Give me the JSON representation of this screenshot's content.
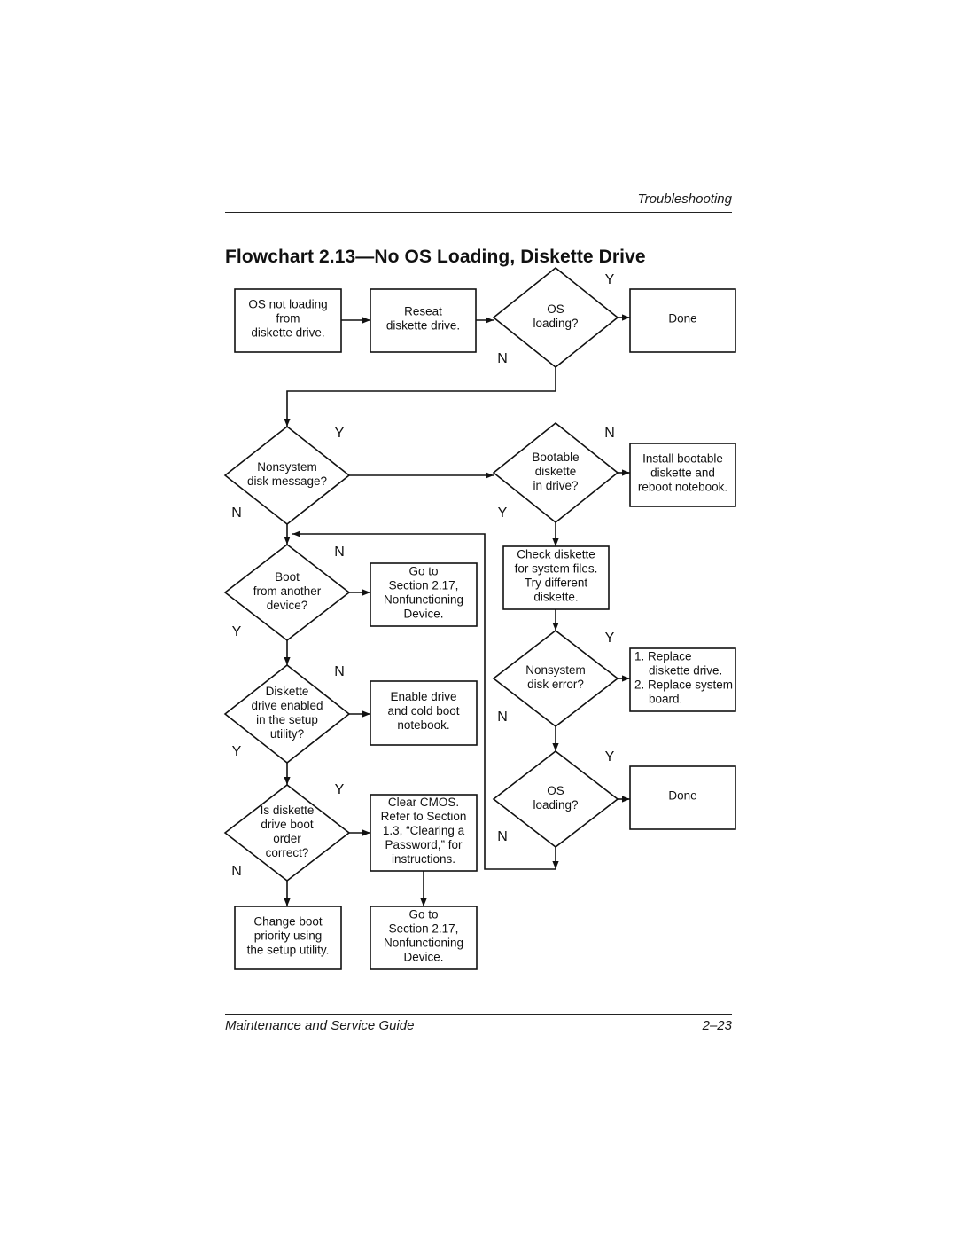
{
  "page": {
    "running_header": "Troubleshooting",
    "title": "Flowchart 2.13—No OS Loading, Diskette Drive",
    "footer_left": "Maintenance and Service Guide",
    "footer_right": "2–23"
  },
  "flowchart": {
    "nodes": {
      "start": {
        "type": "process",
        "lines": [
          "OS not loading",
          "from",
          "diskette drive."
        ]
      },
      "reseat": {
        "type": "process",
        "lines": [
          "Reseat",
          "diskette drive."
        ]
      },
      "os_loading_1": {
        "type": "decision",
        "lines": [
          "OS",
          "loading?"
        ]
      },
      "done_1": {
        "type": "process",
        "lines": [
          "Done"
        ]
      },
      "nonsystem_msg": {
        "type": "decision",
        "lines": [
          "Nonsystem",
          "disk message?"
        ]
      },
      "bootable": {
        "type": "decision",
        "lines": [
          "Bootable",
          "diskette",
          "in drive?"
        ]
      },
      "install_bootable": {
        "type": "process",
        "lines": [
          "Install bootable",
          "diskette and",
          "reboot notebook."
        ]
      },
      "check_diskette": {
        "type": "process",
        "lines": [
          "Check diskette",
          "for system files.",
          "Try different",
          "diskette."
        ]
      },
      "boot_other": {
        "type": "decision",
        "lines": [
          "Boot",
          "from another",
          "device?"
        ]
      },
      "goto_217_a": {
        "type": "process",
        "lines": [
          "Go to",
          "Section 2.17,",
          "Nonfunctioning",
          "Device."
        ]
      },
      "drive_enabled": {
        "type": "decision",
        "lines": [
          "Diskette",
          "drive enabled",
          "in the setup",
          "utility?"
        ]
      },
      "enable_drive": {
        "type": "process",
        "lines": [
          "Enable drive",
          "and cold boot",
          "notebook."
        ]
      },
      "boot_order": {
        "type": "decision",
        "lines": [
          "Is diskette",
          "drive boot",
          "order",
          "correct?"
        ]
      },
      "clear_cmos": {
        "type": "process",
        "lines": [
          "Clear CMOS.",
          "Refer to Section",
          "1.3, “Clearing a",
          "Password,” for",
          "instructions."
        ]
      },
      "change_boot": {
        "type": "process",
        "lines": [
          "Change boot",
          "priority using",
          "the setup utility."
        ]
      },
      "goto_217_b": {
        "type": "process",
        "lines": [
          "Go to",
          "Section 2.17,",
          "Nonfunctioning",
          "Device."
        ]
      },
      "disk_error": {
        "type": "decision",
        "lines": [
          "Nonsystem",
          "disk error?"
        ]
      },
      "replace": {
        "type": "process",
        "lines": [
          "1. Replace",
          "diskette drive.",
          "2. Replace system",
          "board."
        ]
      },
      "os_loading_2": {
        "type": "decision",
        "lines": [
          "OS",
          "loading?"
        ]
      },
      "done_2": {
        "type": "process",
        "lines": [
          "Done"
        ]
      }
    },
    "branch_labels": {
      "os_loading_1_yes": "Y",
      "os_loading_1_no": "N",
      "nonsystem_msg_yes": "Y",
      "nonsystem_msg_no": "N",
      "bootable_no": "N",
      "bootable_yes": "Y",
      "boot_other_no": "N",
      "boot_other_yes": "Y",
      "drive_enabled_no": "N",
      "drive_enabled_yes": "Y",
      "boot_order_yes": "Y",
      "boot_order_no": "N",
      "disk_error_yes": "Y",
      "disk_error_no": "N",
      "os_loading_2_yes": "Y",
      "os_loading_2_no": "N"
    },
    "edges": [
      [
        "start",
        "reseat"
      ],
      [
        "reseat",
        "os_loading_1"
      ],
      [
        "os_loading_1",
        "done_1",
        "Y"
      ],
      [
        "os_loading_1",
        "nonsystem_msg",
        "N"
      ],
      [
        "nonsystem_msg",
        "bootable",
        "Y"
      ],
      [
        "nonsystem_msg",
        "boot_other",
        "N"
      ],
      [
        "bootable",
        "install_bootable",
        "N"
      ],
      [
        "bootable",
        "check_diskette",
        "Y"
      ],
      [
        "check_diskette",
        "disk_error"
      ],
      [
        "disk_error",
        "replace",
        "Y"
      ],
      [
        "disk_error",
        "os_loading_2",
        "N"
      ],
      [
        "os_loading_2",
        "done_2",
        "Y"
      ],
      [
        "os_loading_2",
        "boot_other",
        "N"
      ],
      [
        "boot_other",
        "goto_217_a",
        "N"
      ],
      [
        "boot_other",
        "drive_enabled",
        "Y"
      ],
      [
        "drive_enabled",
        "enable_drive",
        "N"
      ],
      [
        "drive_enabled",
        "boot_order",
        "Y"
      ],
      [
        "boot_order",
        "clear_cmos",
        "Y"
      ],
      [
        "boot_order",
        "change_boot",
        "N"
      ],
      [
        "clear_cmos",
        "goto_217_b"
      ]
    ]
  }
}
